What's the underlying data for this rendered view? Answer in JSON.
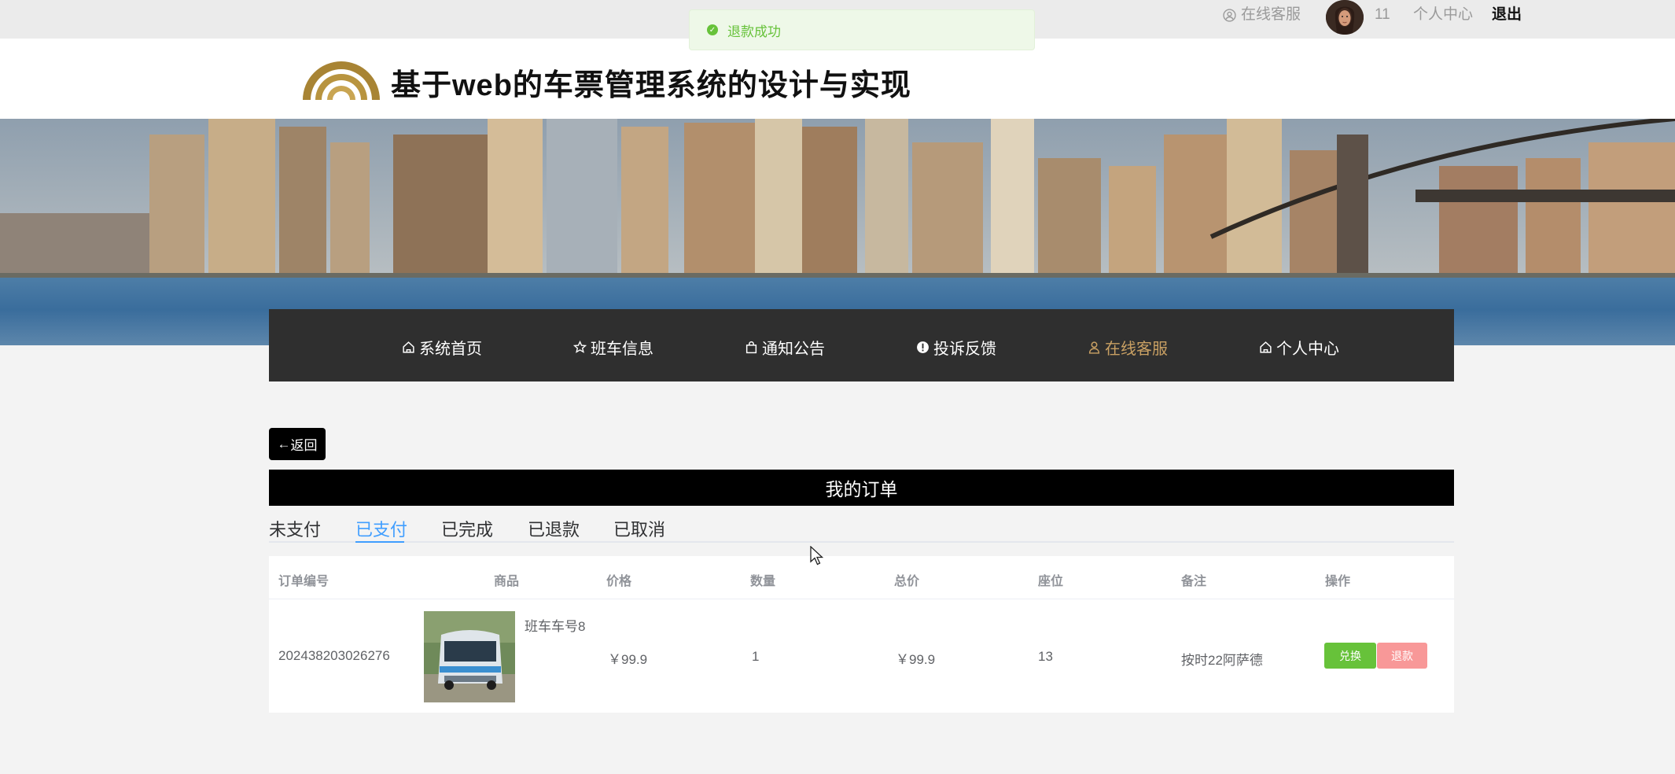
{
  "topbar": {
    "online_service": "在线客服",
    "username": "11",
    "personal_center": "个人中心",
    "logout": "退出"
  },
  "toast": {
    "message": "退款成功"
  },
  "header": {
    "title": "基于web的车票管理系统的设计与实现"
  },
  "nav": {
    "items": [
      {
        "label": "系统首页",
        "icon": "home-icon"
      },
      {
        "label": "班车信息",
        "icon": "star-icon"
      },
      {
        "label": "通知公告",
        "icon": "bag-icon"
      },
      {
        "label": "投诉反馈",
        "icon": "alert-icon"
      },
      {
        "label": "在线客服",
        "icon": "user-icon",
        "active": true
      },
      {
        "label": "个人中心",
        "icon": "home-icon"
      }
    ]
  },
  "back_label": "返回",
  "orders_title": "我的订单",
  "tabs": [
    {
      "label": "未支付"
    },
    {
      "label": "已支付",
      "active": true
    },
    {
      "label": "已完成"
    },
    {
      "label": "已退款"
    },
    {
      "label": "已取消"
    }
  ],
  "table": {
    "headers": [
      "订单编号",
      "商品",
      "价格",
      "数量",
      "总价",
      "座位",
      "备注",
      "操作"
    ],
    "rows": [
      {
        "order_no": "202438203026276",
        "product": "班车车号8",
        "price": "￥99.9",
        "quantity": "1",
        "total": "￥99.9",
        "seat": "13",
        "remark": "按时22阿萨德",
        "actions": {
          "exchange": "兑换",
          "refund": "退款"
        }
      }
    ]
  },
  "colors": {
    "accent_gold": "#c9a063",
    "success_green": "#67c23a",
    "tab_blue": "#409eff",
    "refund_pink": "#f89898"
  }
}
